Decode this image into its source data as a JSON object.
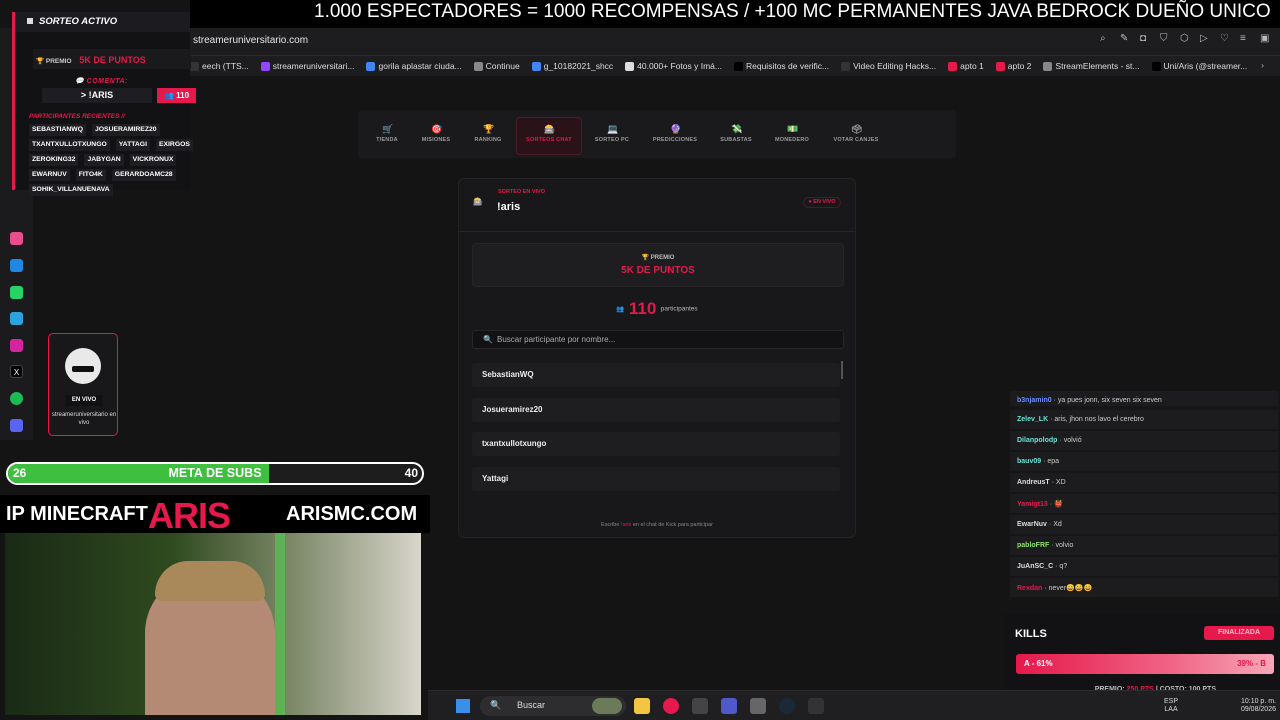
{
  "ticker": {
    "text": "1.000 ESPECTADORES = 1000 RECOMPENSAS / +100 MC PERMANENTES JAVA BEDROCK DUEÑO UNICO"
  },
  "browser": {
    "url": "streameruniversitario.com",
    "bookmarks": [
      {
        "label": "eech (TTS...",
        "color": "#333"
      },
      {
        "label": "streameruniversitari...",
        "color": "#9146ff"
      },
      {
        "label": "gorila aplastar ciuda...",
        "color": "#4285f4"
      },
      {
        "label": "Continue",
        "color": "#888"
      },
      {
        "label": "g_10182021_shcc",
        "color": "#4285f4"
      },
      {
        "label": "40.000+ Fotos y Imá...",
        "color": "#ddd"
      },
      {
        "label": "Requisitos de verific...",
        "color": "#000"
      },
      {
        "label": "Video Editing Hacks...",
        "color": "#333"
      },
      {
        "label": "apto 1",
        "color": "#e5194b"
      },
      {
        "label": "apto 2",
        "color": "#e5194b"
      },
      {
        "label": "StreamElements - st...",
        "color": "#888"
      },
      {
        "label": "Uni/Aris (@streamer...",
        "color": "#000"
      }
    ]
  },
  "overlay": {
    "header": "SORTEO ACTIVO",
    "prize_label": "PREMIO",
    "prize_value": "5K DE PUNTOS",
    "comment_label": "COMENTA:",
    "command": "> !ARIS",
    "count": "110",
    "participants_title": "PARTICIPANTES RECIENTES //",
    "participants": [
      "SEBASTIANWQ",
      "JOSUERAMIREZ20",
      "TXANTXULLOTXUNGO",
      "YATTAGI",
      "EXIRGOS",
      "ZEROKING32",
      "JABYGAN",
      "VICKRONUX",
      "EWARNUV",
      "FITO4K",
      "GERARDOAMC28",
      "SOHIK_VILLANUENAVA"
    ]
  },
  "streamer_card": {
    "live": "EN VIVO",
    "name": "streameruniversitario en vivo"
  },
  "subs": {
    "start": "26",
    "end": "40",
    "label": "META DE SUBS",
    "progress": 0.63
  },
  "ip_banner": {
    "left": "IP MINECRAFT",
    "middle": "ARIS",
    "right": "ARISMC.COM"
  },
  "nav": {
    "tabs": [
      {
        "label": "TIENDA",
        "icon": "🛒",
        "active": false
      },
      {
        "label": "MISIONES",
        "icon": "🎯",
        "active": false
      },
      {
        "label": "RANKING",
        "icon": "🏆",
        "active": false
      },
      {
        "label": "SORTEOS CHAT",
        "icon": "🎰",
        "active": true
      },
      {
        "label": "SORTEO PC",
        "icon": "💻",
        "active": false
      },
      {
        "label": "PREDICCIONES",
        "icon": "🔮",
        "active": false
      },
      {
        "label": "SUBASTAS",
        "icon": "💸",
        "active": false
      },
      {
        "label": "MONEDERO",
        "icon": "💵",
        "active": false
      },
      {
        "label": "VOTAR CANJES",
        "icon": "🗳",
        "active": false
      }
    ]
  },
  "card": {
    "subtitle": "SORTEO EN VIVO",
    "title": "!aris",
    "live": "● EN VIVO",
    "prize_label": "🏆 PREMIO",
    "prize_value": "5K DE PUNTOS",
    "participants_count": "110",
    "participants_label": "participantes",
    "search_placeholder": "Buscar participante por nombre...",
    "participants": [
      "SebastianWQ",
      "Josueramirez20",
      "txantxullotxungo",
      "Yattagi"
    ],
    "footer_pre": "Escribe",
    "footer_cmd": "!aris",
    "footer_post": "en el chat de Kick para participar"
  },
  "chat": {
    "messages": [
      {
        "user": "b3njamin0",
        "text": "ya pues jonn, six seven six seven",
        "color": "#6a8cff"
      },
      {
        "user": "Zelev_LK",
        "text": "aris, jhon nos lavo el cerebro",
        "color": "#6ae3d6"
      },
      {
        "user": "Dilanpolodp",
        "text": "volvió",
        "color": "#6ae3d6"
      },
      {
        "user": "bauv09",
        "text": "epa",
        "color": "#6ae3d6"
      },
      {
        "user": "AndreusT",
        "text": "XD",
        "color": "#dddddd"
      },
      {
        "user": "Yamigt13",
        "text": "👹",
        "color": "#e5194b"
      },
      {
        "user": "EwarNuv",
        "text": "Xd",
        "color": "#dddddd"
      },
      {
        "user": "pabloFRF",
        "text": "volvio",
        "color": "#8be36a"
      },
      {
        "user": "JuAnSC_C",
        "text": "q?",
        "color": "#dddddd"
      },
      {
        "user": "Rexdan",
        "text": "never😄😄😄",
        "color": "#e5194b"
      }
    ]
  },
  "kills": {
    "title": "KILLS",
    "status": "FINALIZADA",
    "left_label": "A - 61%",
    "right_label": "39% - B",
    "prize_pre": "PREMIO:",
    "prize_value": "250 PTS",
    "cost": "| COSTO: 100 PTS"
  },
  "taskbar": {
    "search": "Buscar",
    "lang_1": "ESP",
    "lang_2": "LAA",
    "time": "10:10 p. m.",
    "date": "09/08/2026"
  },
  "colors": {
    "accent": "#e5194b",
    "subs_fill": "#3fbf3f"
  }
}
